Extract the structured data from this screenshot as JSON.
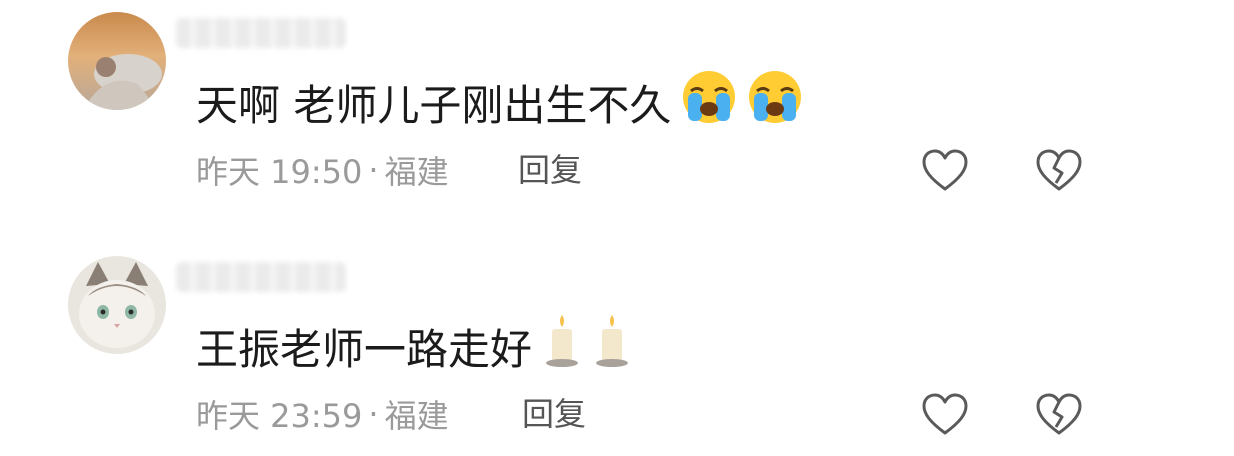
{
  "comments": [
    {
      "text": "天啊 老师儿子刚出生不久",
      "emoji": [
        "loudly-crying-face-icon",
        "loudly-crying-face-icon"
      ],
      "time": "昨天 19:50",
      "separator": "·",
      "location": "福建",
      "reply_label": "回复",
      "like_icon": "heart-outline-icon",
      "dislike_icon": "broken-heart-outline-icon"
    },
    {
      "text": "王振老师一路走好",
      "emoji": [
        "candle-icon",
        "candle-icon"
      ],
      "time": "昨天 23:59",
      "separator": "·",
      "location": "福建",
      "reply_label": "回复",
      "like_icon": "heart-outline-icon",
      "dislike_icon": "broken-heart-outline-icon"
    }
  ],
  "colors": {
    "text": "#1b1b1b",
    "meta": "#9a9a9a",
    "reply": "#555555",
    "icon_stroke": "#5a5a5a"
  }
}
